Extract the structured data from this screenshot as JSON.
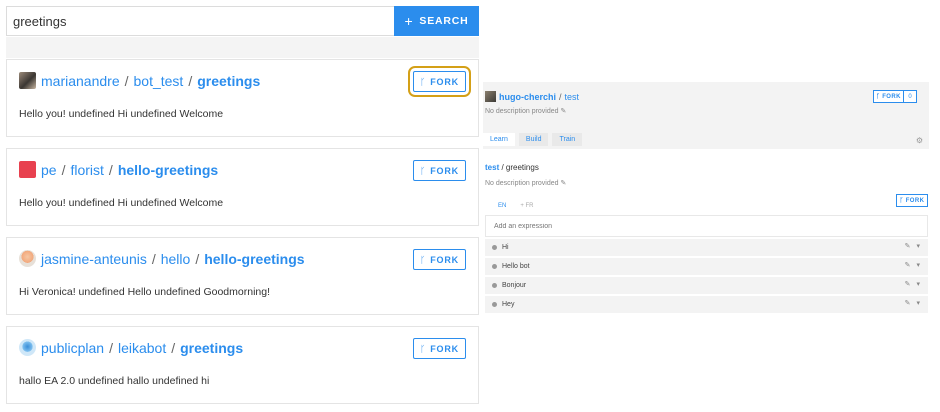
{
  "search": {
    "value": "greetings",
    "button_label": "SEARCH"
  },
  "results": [
    {
      "owner": "marianandre",
      "project": "bot_test",
      "repo": "greetings",
      "description": "Hello you! undefined Hi undefined Welcome",
      "fork_label": "FORK"
    },
    {
      "owner": "pe",
      "project": "florist",
      "repo": "hello-greetings",
      "description": "Hello you! undefined Hi undefined Welcome",
      "fork_label": "FORK"
    },
    {
      "owner": "jasmine-anteunis",
      "project": "hello",
      "repo": "hello-greetings",
      "description": "Hi Veronica! undefined Hello undefined Goodmorning!",
      "fork_label": "FORK"
    },
    {
      "owner": "publicplan",
      "project": "leikabot",
      "repo": "greetings",
      "description": "hallo EA 2.0 undefined hallo undefined hi",
      "fork_label": "FORK"
    }
  ],
  "detail": {
    "owner": "hugo-cherchi",
    "project": "test",
    "description": "No description provided",
    "fork_label": "FORK",
    "fork_count": "0",
    "tabs": [
      "Learn",
      "Build",
      "Train"
    ],
    "intent_owner": "test",
    "intent_name": "greetings",
    "intent_description": "No description provided",
    "intent_fork_label": "FORK",
    "languages": [
      "EN",
      "+ FR"
    ],
    "add_placeholder": "Add an expression",
    "expressions": [
      "Hi",
      "Hello bot",
      "Bonjour",
      "Hey"
    ]
  },
  "colors": {
    "accent": "#2b8ded",
    "focus_outline": "#d4a017"
  }
}
